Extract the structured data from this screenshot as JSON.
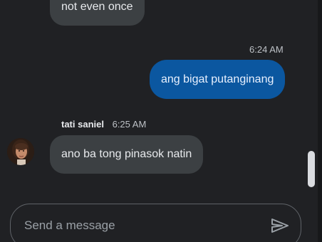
{
  "messages": {
    "top_partial": {
      "text": "not even once"
    },
    "outgoing": {
      "time": "6:24 AM",
      "text": "ang bigat putanginang"
    },
    "incoming": {
      "sender": "tati saniel",
      "time": "6:25 AM",
      "text": "ano ba tong pinasok natin"
    }
  },
  "composer": {
    "placeholder": "Send a message",
    "send_icon": "send-icon"
  },
  "colors": {
    "background": "#202124",
    "incoming_bubble": "#3c4043",
    "outgoing_bubble": "#0b57a0"
  }
}
